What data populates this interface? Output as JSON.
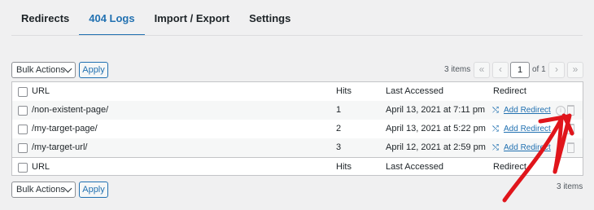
{
  "tabs": [
    {
      "label": "Redirects"
    },
    {
      "label": "404 Logs"
    },
    {
      "label": "Import / Export"
    },
    {
      "label": "Settings"
    }
  ],
  "active_tab": "404 Logs",
  "top_nav": {
    "bulk_actions": "Bulk Actions",
    "apply": "Apply",
    "items_count": "3 items",
    "pagination": {
      "first": "«",
      "prev": "‹",
      "current_page": "1",
      "of": "of 1",
      "next": "›",
      "last": "»"
    }
  },
  "table": {
    "columns": {
      "url": "URL",
      "hits": "Hits",
      "last_accessed": "Last Accessed",
      "redirect": "Redirect"
    },
    "rows": [
      {
        "url": "/non-existent-page/",
        "hits": "1",
        "last_accessed": "April 13, 2021 at 7:11 pm",
        "action": "Add Redirect"
      },
      {
        "url": "/my-target-page/",
        "hits": "2",
        "last_accessed": "April 13, 2021 at 5:22 pm",
        "action": "Add Redirect"
      },
      {
        "url": "/my-target-url/",
        "hits": "3",
        "last_accessed": "April 12, 2021 at 2:59 pm",
        "action": "Add Redirect"
      }
    ]
  },
  "bottom_nav": {
    "bulk_actions": "Bulk Actions",
    "apply": "Apply",
    "items_count": "3 items"
  },
  "icons": {
    "add_redirect": "shuffle-icon",
    "info": "info-icon",
    "delete": "trash-icon"
  },
  "annotation": {
    "arrow_color": "#e0151b"
  }
}
